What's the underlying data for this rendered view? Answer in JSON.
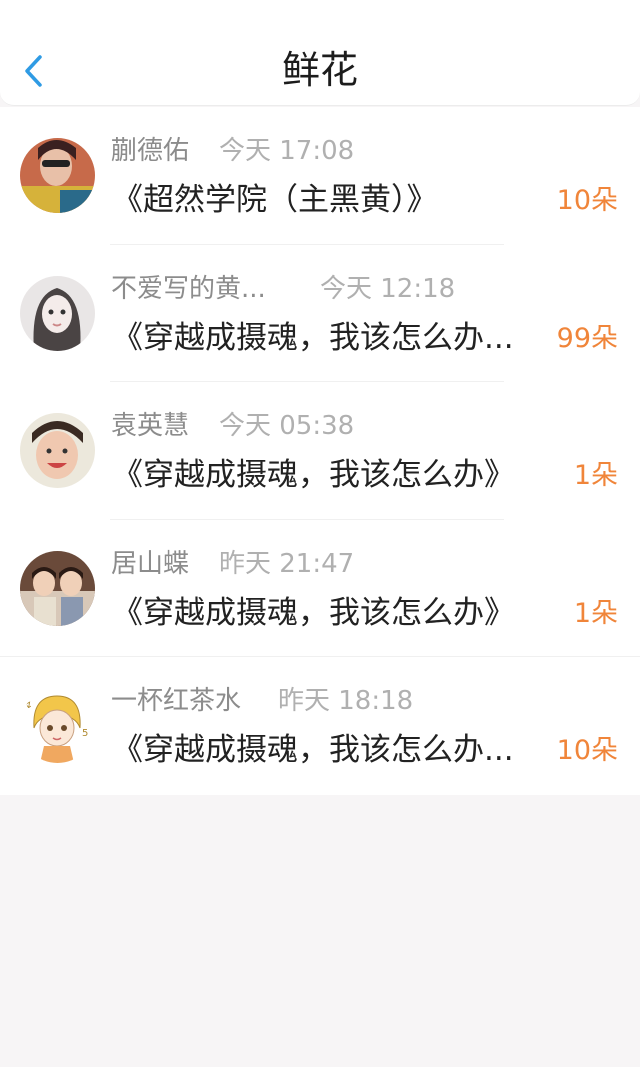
{
  "header": {
    "title": "鲜花"
  },
  "items": [
    {
      "name": "蒯德佑",
      "time": "今天 17:08",
      "book": "《超然学院（主黑黄）》",
      "count": "10朵"
    },
    {
      "name": "不爱写的黄...",
      "time": "今天 12:18",
      "book": "《穿越成摄魂，我该怎么办...",
      "count": "99朵"
    },
    {
      "name": "袁英慧",
      "time": "今天 05:38",
      "book": "《穿越成摄魂，我该怎么办》",
      "count": "1朵"
    },
    {
      "name": "居山蝶",
      "time": "昨天 21:47",
      "book": "《穿越成摄魂，我该怎么办》",
      "count": "1朵"
    },
    {
      "name": "一杯红茶水",
      "time": "昨天 18:18",
      "book": "《穿越成摄魂，我该怎么办...",
      "count": "10朵"
    }
  ],
  "colors": {
    "accent": "#2f9be4",
    "count": "#f0853a",
    "name": "#8c8c8c",
    "time": "#b0b0b0"
  },
  "icons": {
    "back": "chevron-left-icon"
  }
}
